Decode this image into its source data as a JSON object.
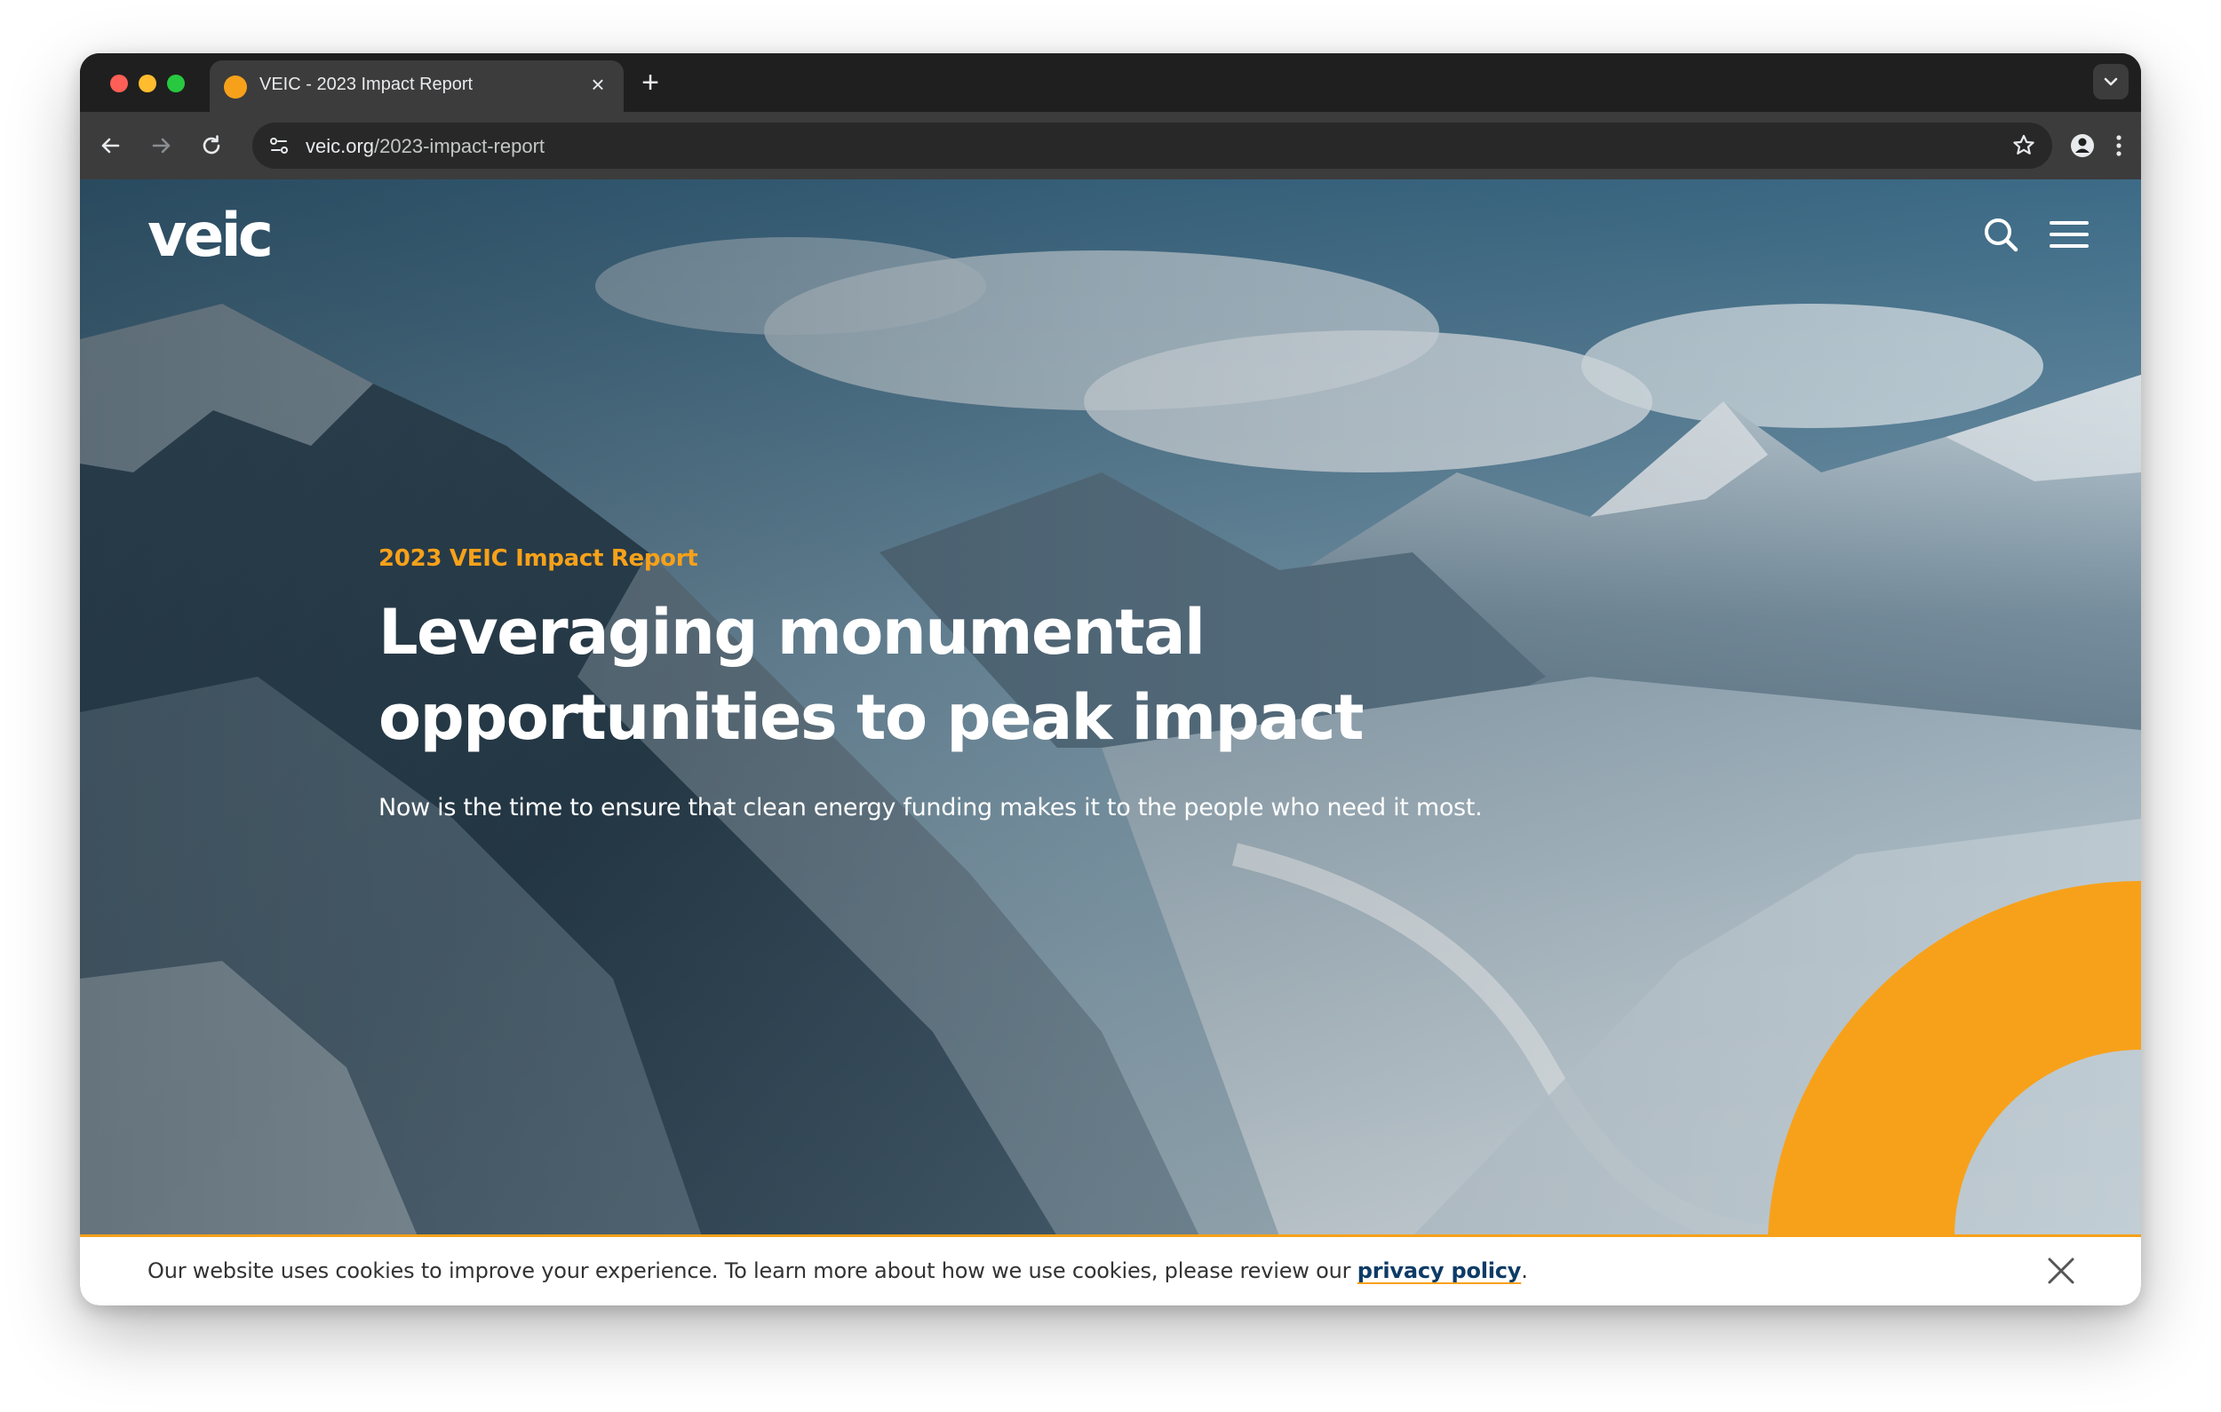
{
  "browser": {
    "tab": {
      "title": "VEIC - 2023 Impact Report",
      "favicon": "veic-favicon-icon",
      "close_glyph": "×"
    },
    "new_tab_glyph": "+",
    "address": {
      "domain": "veic.org",
      "path": "/2023-impact-report"
    }
  },
  "site": {
    "logo_text": "veic",
    "nav": {
      "search_icon": "search-icon",
      "menu_icon": "hamburger-menu-icon"
    }
  },
  "hero": {
    "eyebrow": "2023 VEIC Impact Report",
    "headline_line1": "Leveraging monumental",
    "headline_line2": "opportunities to peak impact",
    "subhead": "Now is the time to ensure that clean energy funding makes it to the people who need it most."
  },
  "cookie": {
    "text": "Our website uses cookies to improve your experience. To learn more about how we use cookies, please review our ",
    "link_text": "privacy policy",
    "text_end": ".",
    "close_icon": "close-icon"
  },
  "colors": {
    "accent_orange": "#f7a11a",
    "link_navy": "#0d3b66",
    "browser_dark": "#1f1f1f",
    "toolbar": "#3c3c3c"
  }
}
